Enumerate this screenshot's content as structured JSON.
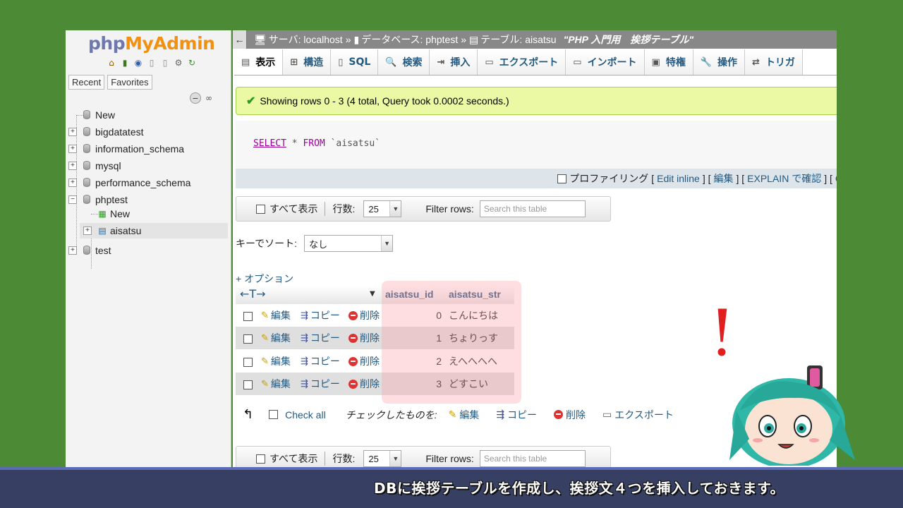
{
  "sidebar": {
    "logo": {
      "php": "php",
      "my": "My",
      "admin": "Admin"
    },
    "tabs": [
      "Recent",
      "Favorites"
    ],
    "tree": [
      {
        "label": "New",
        "kind": "new"
      },
      {
        "label": "bigdatatest",
        "kind": "db"
      },
      {
        "label": "information_schema",
        "kind": "db"
      },
      {
        "label": "mysql",
        "kind": "db"
      },
      {
        "label": "performance_schema",
        "kind": "db"
      },
      {
        "label": "phptest",
        "kind": "db-open"
      },
      {
        "label": "New",
        "kind": "table-new"
      },
      {
        "label": "aisatsu",
        "kind": "table"
      },
      {
        "label": "test",
        "kind": "db"
      }
    ]
  },
  "breadcrumb": {
    "server": "サーバ: localhost",
    "database": "データベース: phptest",
    "table": "テーブル: aisatsu",
    "comment": "\"PHP 入門用　挨拶テーブル\""
  },
  "menu": [
    {
      "label": "表示",
      "icon": "browse-icon"
    },
    {
      "label": "構造",
      "icon": "structure-icon"
    },
    {
      "label": "SQL",
      "icon": "sql-icon"
    },
    {
      "label": "検索",
      "icon": "search-icon"
    },
    {
      "label": "挿入",
      "icon": "insert-icon"
    },
    {
      "label": "エクスポート",
      "icon": "export-icon"
    },
    {
      "label": "インポート",
      "icon": "import-icon"
    },
    {
      "label": "特権",
      "icon": "privileges-icon"
    },
    {
      "label": "操作",
      "icon": "operations-icon"
    },
    {
      "label": "トリガ",
      "icon": "triggers-icon"
    }
  ],
  "success_message": "Showing rows 0 - 3 (4 total, Query took 0.0002 seconds.)",
  "sql": {
    "select": "SELECT",
    "star": " * ",
    "from": "FROM",
    "table": " `aisatsu`"
  },
  "profiling": {
    "label": "プロファイリング",
    "edit_inline": "Edit inline",
    "edit": "編集",
    "explain": "EXPLAIN で確認",
    "trailing": "C"
  },
  "navbar": {
    "show_all": "すべて表示",
    "rows_label": "行数:",
    "rows_value": "25",
    "filter_label": "Filter rows:",
    "filter_placeholder": "Search this table"
  },
  "sort": {
    "label": "キーでソート:",
    "value": "なし"
  },
  "options_link": "+ オプション",
  "table": {
    "columns": [
      "aisatsu_id",
      "aisatsu_str"
    ],
    "actions": {
      "edit": "編集",
      "copy": "コピー",
      "delete": "削除"
    },
    "rows": [
      {
        "id": "0",
        "str": "こんにちは"
      },
      {
        "id": "1",
        "str": "ちょりっす"
      },
      {
        "id": "2",
        "str": "えへへへへ"
      },
      {
        "id": "3",
        "str": "どすこい"
      }
    ]
  },
  "bulk": {
    "check_all": "Check all",
    "with_selected": "チェックしたものを:",
    "edit": "編集",
    "copy": "コピー",
    "delete": "削除",
    "export": "エクスポート"
  },
  "caption": "DBに挨拶テーブルを作成し、挨拶文４つを挿入しておきます。",
  "colors": {
    "background": "#4d8a35",
    "accent": "#235a81",
    "success_bg": "#ebf8a4",
    "caption_bg": "#374063"
  }
}
